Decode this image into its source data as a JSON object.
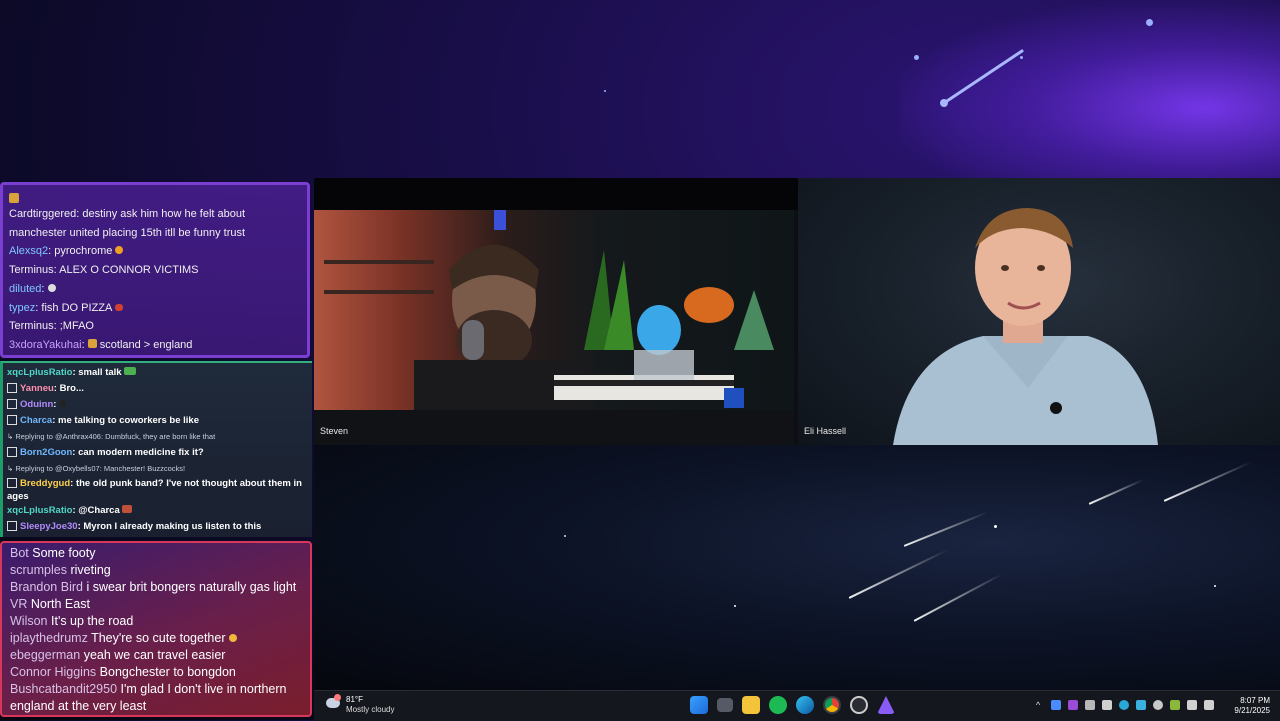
{
  "chat_top": {
    "messages": [
      {
        "user": "Cardtirggered",
        "text": "destiny ask him how he felt about manchester united placing 15th itll be funny trust"
      },
      {
        "user": "Alexsq2",
        "text": "pyrochrome"
      },
      {
        "user": "Terminus",
        "text": "ALEX O CONNOR VICTIMS"
      },
      {
        "user": "diluted",
        "text": ""
      },
      {
        "user": "typez",
        "text": "fish DO PIZZA"
      },
      {
        "user": "Terminus",
        "text": ";MFAO"
      },
      {
        "user": "3xdoraYakuhai",
        "text": "scotland > england"
      }
    ]
  },
  "chat_mid": {
    "messages": [
      {
        "user": "xqcLplusRatio",
        "text": "small talk"
      },
      {
        "user": "Yanneu",
        "text": "Bro..."
      },
      {
        "user": "Oduinn",
        "text": ""
      },
      {
        "user": "Charca",
        "text": "me talking to coworkers be like"
      },
      {
        "reply": "Replying to @Anthrax406: Dumbfuck, they are born like that"
      },
      {
        "user": "Born2Goon",
        "text": "can modern medicine fix it?"
      },
      {
        "reply": "Replying to @Oxybells07: Manchester! Buzzcocks!"
      },
      {
        "user": "Breddygud",
        "text": "the old punk band? I've not thought about them in ages"
      },
      {
        "user": "xqcLplusRatio",
        "text": "@Charca"
      },
      {
        "user": "SleepyJoe30",
        "text": "Myron I already making us listen to this"
      }
    ]
  },
  "chat_bottom": {
    "messages": [
      {
        "user": "Bot",
        "text": "Some footy"
      },
      {
        "user": "scrumples",
        "text": "riveting"
      },
      {
        "user": "Brandon Bird",
        "text": "i swear brit bongers naturally gas light"
      },
      {
        "user": "VR",
        "text": "North East"
      },
      {
        "user": "Wilson",
        "text": "It's up the road"
      },
      {
        "user": "iplaythedrumz",
        "text": "They're so cute together"
      },
      {
        "user": "ebeggerman",
        "text": "yeah we can travel easier"
      },
      {
        "user": "Connor Higgins",
        "text": "Bongchester to bongdon"
      },
      {
        "user": "Bushcatbandit2950",
        "text": "I'm glad I don't live in northern england at the very least"
      }
    ]
  },
  "video": {
    "left_name": "Steven",
    "right_name": "Eli Hassell"
  },
  "taskbar": {
    "temperature": "81°F",
    "weather": "Mostly cloudy",
    "time": "8:07 PM",
    "date": "9/21/2025",
    "apps": [
      "windows-start",
      "task-view",
      "file-explorer",
      "spotify",
      "edge",
      "chrome",
      "obs",
      "app-purple"
    ]
  },
  "colors": {
    "chat_top_border": "#7a3fd0",
    "chat_mid_border": "#2fb07c",
    "chat_bottom_border": "#d7375a",
    "taskbar_bg": "#16181e"
  }
}
